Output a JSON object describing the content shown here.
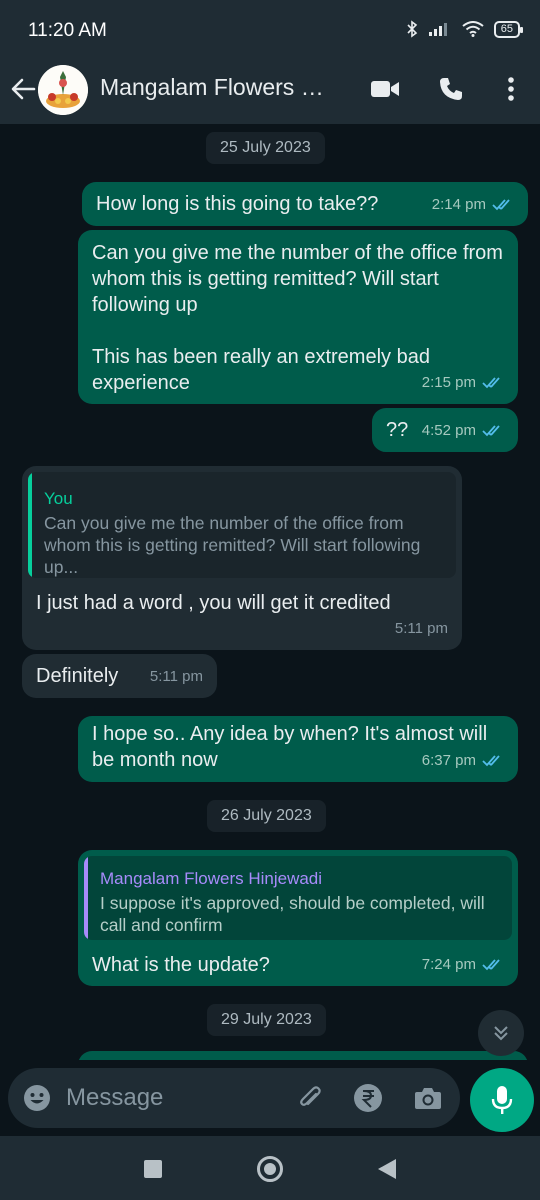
{
  "status_bar": {
    "time": "11:20 AM",
    "battery": "65"
  },
  "header": {
    "contact_name": "Mangalam Flowers Hinjewadi",
    "icons": [
      "back-arrow-icon",
      "video-call-icon",
      "voice-call-icon",
      "more-options-icon"
    ]
  },
  "colors": {
    "outgoing_bubble": "#005c4b",
    "incoming_bubble": "#202c33",
    "accent_green": "#00a884",
    "read_tick": "#53bdeb",
    "quote_you": "#06cf9c",
    "quote_contact": "#a78bfa"
  },
  "chat": {
    "date_1": "25 July 2023",
    "date_2": "26 July 2023",
    "date_3": "29 July 2023",
    "messages": [
      {
        "dir": "out",
        "text": "How long is this going to take??",
        "time": "2:14 pm",
        "read": true
      },
      {
        "dir": "out",
        "text": "Can you give me the number of the office from whom this is getting remitted? Will start following up\n\nThis has been really an extremely bad experience",
        "time": "2:15 pm",
        "read": true
      },
      {
        "dir": "out",
        "text": "??",
        "time": "4:52 pm",
        "read": true
      },
      {
        "dir": "in",
        "quote_author": "You",
        "quote_text": "Can you give me the number of the office from whom this is getting remitted? Will start following up...",
        "text": "I just had a word , you will get it credited",
        "time": "5:11 pm"
      },
      {
        "dir": "in",
        "text": "Definitely",
        "time": "5:11 pm"
      },
      {
        "dir": "out",
        "text": "I hope so.. Any idea by when? It's almost will be month now",
        "time": "6:37 pm",
        "read": true
      },
      {
        "dir": "out",
        "quote_author": "Mangalam Flowers Hinjewadi",
        "quote_text": "I suppose it's approved, should be completed, will call and confirm",
        "text": "What is the update?",
        "time": "7:24 pm",
        "read": true
      }
    ]
  },
  "input": {
    "placeholder": "Message"
  }
}
